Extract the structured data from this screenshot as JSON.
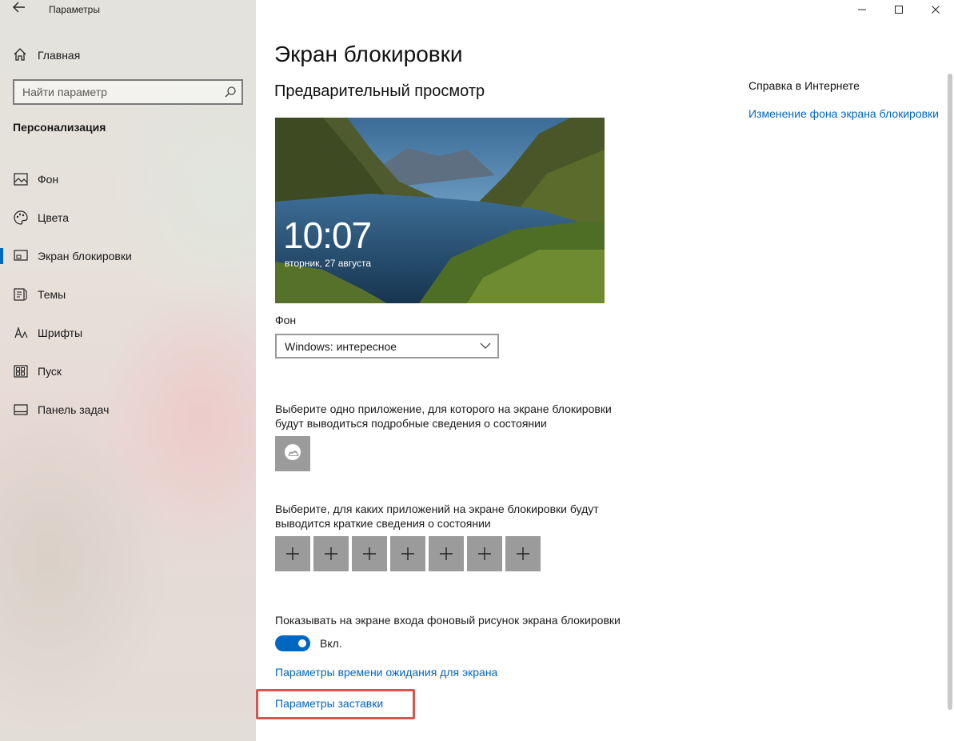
{
  "window": {
    "title": "Параметры",
    "back_icon": "back-arrow-icon",
    "controls": {
      "minimize": "—",
      "maximize": "☐",
      "close": "✕"
    }
  },
  "sidebar": {
    "home_label": "Главная",
    "search_placeholder": "Найти параметр",
    "section_title": "Персонализация",
    "items": [
      {
        "label": "Фон",
        "icon": "image-icon",
        "active": false
      },
      {
        "label": "Цвета",
        "icon": "palette-icon",
        "active": false
      },
      {
        "label": "Экран блокировки",
        "icon": "lock-screen-icon",
        "active": true
      },
      {
        "label": "Темы",
        "icon": "themes-icon",
        "active": false
      },
      {
        "label": "Шрифты",
        "icon": "fonts-icon",
        "active": false
      },
      {
        "label": "Пуск",
        "icon": "start-icon",
        "active": false
      },
      {
        "label": "Панель задач",
        "icon": "taskbar-icon",
        "active": false
      }
    ]
  },
  "main": {
    "page_title": "Экран блокировки",
    "preview_title": "Предварительный просмотр",
    "preview": {
      "time": "10:07",
      "date": "вторник, 27 августа"
    },
    "background_label": "Фон",
    "background_value": "Windows: интересное",
    "detail_app_text": "Выберите одно приложение, для которого на экране блокировки будут выводиться подробные сведения о состоянии",
    "quick_apps_text": "Выберите, для каких приложений на экране блокировки будут выводится краткие сведения о состоянии",
    "quick_slots": [
      "+",
      "+",
      "+",
      "+",
      "+",
      "+",
      "+"
    ],
    "show_bg_text": "Показывать на экране входа фоновый рисунок экрана блокировки",
    "toggle_state": "Вкл.",
    "timeout_link": "Параметры времени ожидания для экрана",
    "screensaver_link": "Параметры заставки"
  },
  "help": {
    "title": "Справка в Интернете",
    "link": "Изменение фона экрана блокировки"
  },
  "colors": {
    "accent": "#0067c0",
    "highlight": "#d9534f",
    "tile": "#9b9b9b"
  }
}
